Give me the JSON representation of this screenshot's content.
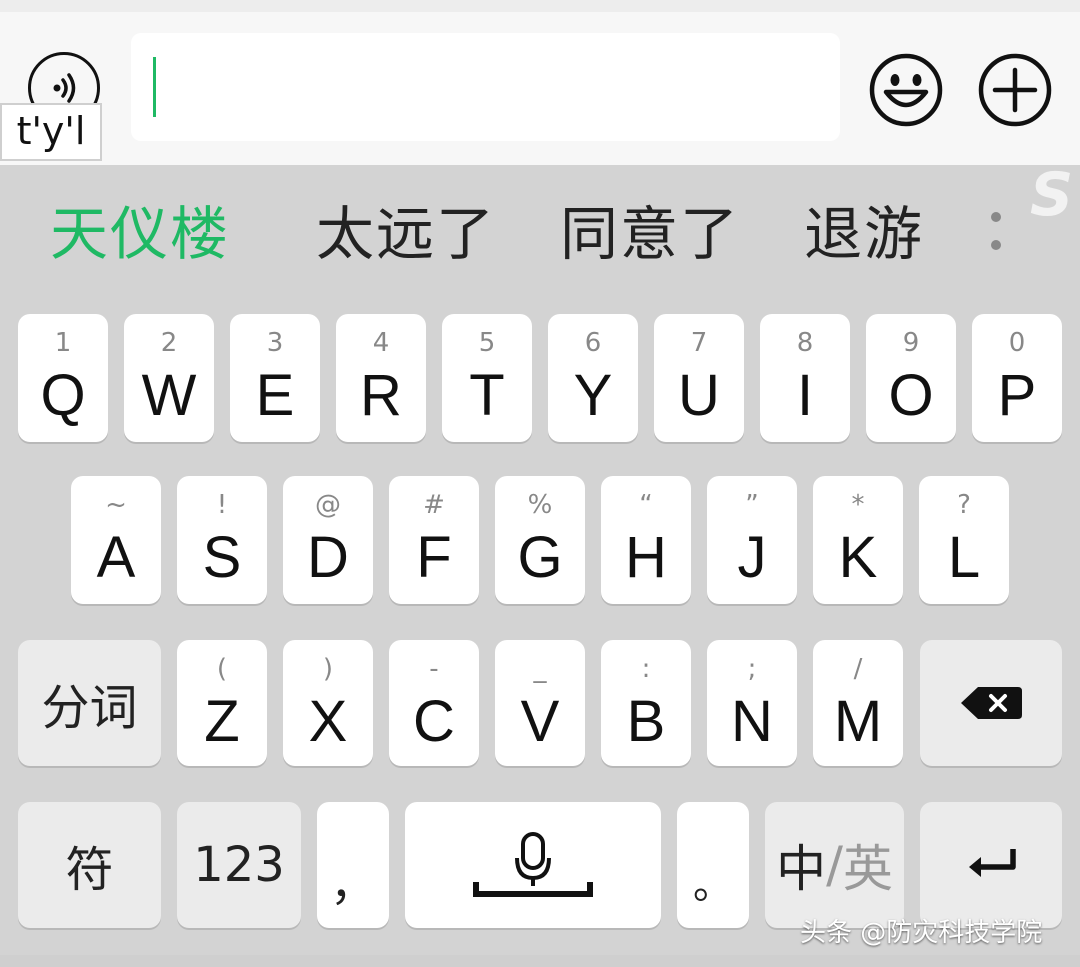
{
  "input_bar": {
    "pinyin_composition": "t'y'l",
    "text_value": ""
  },
  "candidates": [
    "天仪楼",
    "太远了",
    "同意了",
    "退游"
  ],
  "keyboard": {
    "row1": [
      {
        "hint": "1",
        "key": "Q"
      },
      {
        "hint": "2",
        "key": "W"
      },
      {
        "hint": "3",
        "key": "E"
      },
      {
        "hint": "4",
        "key": "R"
      },
      {
        "hint": "5",
        "key": "T"
      },
      {
        "hint": "6",
        "key": "Y"
      },
      {
        "hint": "7",
        "key": "U"
      },
      {
        "hint": "8",
        "key": "I"
      },
      {
        "hint": "9",
        "key": "O"
      },
      {
        "hint": "0",
        "key": "P"
      }
    ],
    "row2": [
      {
        "hint": "~",
        "key": "A"
      },
      {
        "hint": "!",
        "key": "S"
      },
      {
        "hint": "@",
        "key": "D"
      },
      {
        "hint": "#",
        "key": "F"
      },
      {
        "hint": "%",
        "key": "G"
      },
      {
        "hint": "“",
        "key": "H"
      },
      {
        "hint": "”",
        "key": "J"
      },
      {
        "hint": "*",
        "key": "K"
      },
      {
        "hint": "?",
        "key": "L"
      }
    ],
    "row3_left": "分词",
    "row3": [
      {
        "hint": "(",
        "key": "Z"
      },
      {
        "hint": ")",
        "key": "X"
      },
      {
        "hint": "-",
        "key": "C"
      },
      {
        "hint": "_",
        "key": "V"
      },
      {
        "hint": ":",
        "key": "B"
      },
      {
        "hint": ";",
        "key": "N"
      },
      {
        "hint": "/",
        "key": "M"
      }
    ],
    "row4": {
      "symbols": "符",
      "numbers": "123",
      "comma": "，",
      "period": "。",
      "lang_primary": "中",
      "lang_sep": "/",
      "lang_secondary": "英"
    }
  },
  "watermark": "头条 @防灾科技学院",
  "colors": {
    "accent": "#1fb964",
    "keyboard_bg": "#d3d3d3",
    "key_bg": "#ffffff",
    "function_key_bg": "#ebebeb"
  },
  "icons": [
    "voice-icon",
    "emoji-icon",
    "plus-icon",
    "more-icon",
    "backspace-icon",
    "microphone-icon",
    "enter-icon"
  ]
}
